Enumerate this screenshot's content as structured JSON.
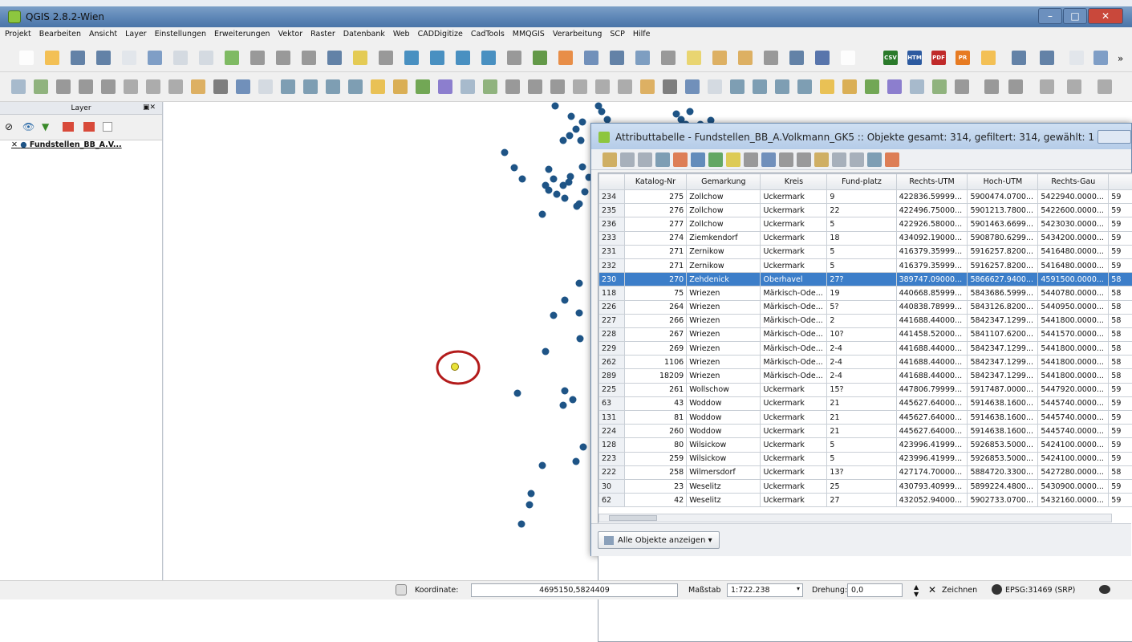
{
  "window": {
    "title": "QGIS 2.8.2-Wien"
  },
  "menu": [
    "Projekt",
    "Bearbeiten",
    "Ansicht",
    "Layer",
    "Einstellungen",
    "Erweiterungen",
    "Vektor",
    "Raster",
    "Datenbank",
    "Web",
    "CADDigitize",
    "CadTools",
    "MMQGIS",
    "Verarbeitung",
    "SCP",
    "Hilfe"
  ],
  "toolbar": {
    "csv": "CSV",
    "htm": "HTM",
    "pdf": "PDF",
    "pr": "PR",
    "more": "»"
  },
  "layers_panel": {
    "title": "Layer",
    "layer_name": "Fundstellen_BB_A.V..."
  },
  "attribute_table": {
    "title": "Attributtabelle - Fundstellen_BB_A.Volkmann_GK5 :: Objekte gesamt: 314, gefiltert: 314, gewählt: 1",
    "columns": [
      "Katalog-Nr",
      "Gemarkung",
      "Kreis",
      "Fund-platz",
      "Rechts-UTM",
      "Hoch-UTM",
      "Rechts-Gau",
      ""
    ],
    "rows": [
      [
        "234",
        "275",
        "Zollchow",
        "Uckermark",
        "9",
        "422836.59999...",
        "5900474.0700...",
        "5422940.0000...",
        "59"
      ],
      [
        "235",
        "276",
        "Zollchow",
        "Uckermark",
        "22",
        "422496.75000...",
        "5901213.7800...",
        "5422600.0000...",
        "59"
      ],
      [
        "236",
        "277",
        "Zollchow",
        "Uckermark",
        "5",
        "422926.58000...",
        "5901463.6699...",
        "5423030.0000...",
        "59"
      ],
      [
        "233",
        "274",
        "Ziemkendorf",
        "Uckermark",
        "18",
        "434092.19000...",
        "5908780.6299...",
        "5434200.0000...",
        "59"
      ],
      [
        "231",
        "271",
        "Zernikow",
        "Uckermark",
        "5",
        "416379.35999...",
        "5916257.8200...",
        "5416480.0000...",
        "59"
      ],
      [
        "232",
        "271",
        "Zernikow",
        "Uckermark",
        "5",
        "416379.35999...",
        "5916257.8200...",
        "5416480.0000...",
        "59"
      ],
      [
        "230",
        "270",
        "Zehdenick",
        "Oberhavel",
        "27?",
        "389747.09000...",
        "5866627.9400...",
        "4591500.0000...",
        "58"
      ],
      [
        "118",
        "75",
        "Wriezen",
        "Märkisch-Ode...",
        "19",
        "440668.85999...",
        "5843686.5999...",
        "5440780.0000...",
        "58"
      ],
      [
        "226",
        "264",
        "Wriezen",
        "Märkisch-Ode...",
        "5?",
        "440838.78999...",
        "5843126.8200...",
        "5440950.0000...",
        "58"
      ],
      [
        "227",
        "266",
        "Wriezen",
        "Märkisch-Ode...",
        "2",
        "441688.44000...",
        "5842347.1299...",
        "5441800.0000...",
        "58"
      ],
      [
        "228",
        "267",
        "Wriezen",
        "Märkisch-Ode...",
        "10?",
        "441458.52000...",
        "5841107.6200...",
        "5441570.0000...",
        "58"
      ],
      [
        "229",
        "269",
        "Wriezen",
        "Märkisch-Ode...",
        "2-4",
        "441688.44000...",
        "5842347.1299...",
        "5441800.0000...",
        "58"
      ],
      [
        "262",
        "1106",
        "Wriezen",
        "Märkisch-Ode...",
        "2-4",
        "441688.44000...",
        "5842347.1299...",
        "5441800.0000...",
        "58"
      ],
      [
        "289",
        "18209",
        "Wriezen",
        "Märkisch-Ode...",
        "2-4",
        "441688.44000...",
        "5842347.1299...",
        "5441800.0000...",
        "58"
      ],
      [
        "225",
        "261",
        "Wollschow",
        "Uckermark",
        "15?",
        "447806.79999...",
        "5917487.0000...",
        "5447920.0000...",
        "59"
      ],
      [
        "63",
        "43",
        "Woddow",
        "Uckermark",
        "21",
        "445627.64000...",
        "5914638.1600...",
        "5445740.0000...",
        "59"
      ],
      [
        "131",
        "81",
        "Woddow",
        "Uckermark",
        "21",
        "445627.64000...",
        "5914638.1600...",
        "5445740.0000...",
        "59"
      ],
      [
        "224",
        "260",
        "Woddow",
        "Uckermark",
        "21",
        "445627.64000...",
        "5914638.1600...",
        "5445740.0000...",
        "59"
      ],
      [
        "128",
        "80",
        "Wilsickow",
        "Uckermark",
        "5",
        "423996.41999...",
        "5926853.5000...",
        "5424100.0000...",
        "59"
      ],
      [
        "223",
        "259",
        "Wilsickow",
        "Uckermark",
        "5",
        "423996.41999...",
        "5926853.5000...",
        "5424100.0000...",
        "59"
      ],
      [
        "222",
        "258",
        "Wilmersdorf",
        "Uckermark",
        "13?",
        "427174.70000...",
        "5884720.3300...",
        "5427280.0000...",
        "58"
      ],
      [
        "30",
        "23",
        "Weselitz",
        "Uckermark",
        "25",
        "430793.40999...",
        "5899224.4800...",
        "5430900.0000...",
        "59"
      ],
      [
        "62",
        "42",
        "Weselitz",
        "Uckermark",
        "27",
        "432052.94000...",
        "5902733.0700...",
        "5432160.0000...",
        "59"
      ]
    ],
    "selected_row": "230",
    "show_all_label": "Alle Objekte anzeigen"
  },
  "status": {
    "coord_label": "Koordinate:",
    "coord_value": "4695150,5824409",
    "scale_label": "Maßstab",
    "scale_value": "1:722.238",
    "rotation_label": "Drehung:",
    "rotation_value": "0,0",
    "render_label": "Zeichnen",
    "crs": "EPSG:31469 (SRP)"
  },
  "colors": {
    "point": "#1e5486",
    "selected_point": "#e8e23a",
    "highlight_circle": "#b31b1b",
    "selection": "#3c7ec9"
  }
}
